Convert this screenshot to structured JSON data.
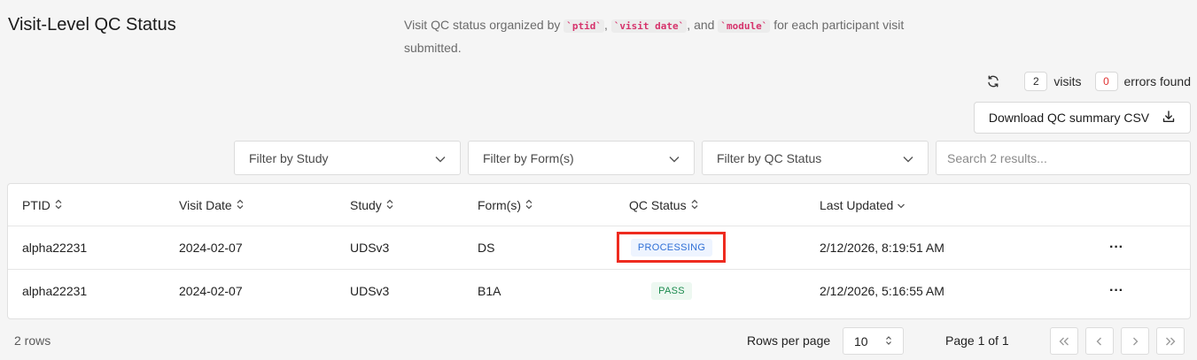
{
  "header": {
    "title": "Visit-Level QC Status",
    "description": {
      "part1": "Visit QC status organized by ",
      "code1": "`ptid`",
      "part2": ", ",
      "code2": "`visit date`",
      "part3": ", and ",
      "code3": "`module`",
      "part4": " for each participant visit submitted."
    }
  },
  "stats": {
    "visits_count": "2",
    "visits_label": "visits",
    "errors_count": "0",
    "errors_label": "errors found"
  },
  "actions": {
    "download_label": "Download QC summary CSV"
  },
  "filters": {
    "study": "Filter by Study",
    "forms": "Filter by Form(s)",
    "qc_status": "Filter by QC Status",
    "search_placeholder": "Search 2 results..."
  },
  "table": {
    "columns": [
      "PTID",
      "Visit Date",
      "Study",
      "Form(s)",
      "QC Status",
      "Last Updated"
    ],
    "rows": [
      {
        "ptid": "alpha22231",
        "visit_date": "2024-02-07",
        "study": "UDSv3",
        "forms": "DS",
        "qc_status": "PROCESSING",
        "last_updated": "2/12/2026, 8:19:51 AM",
        "actions": "···"
      },
      {
        "ptid": "alpha22231",
        "visit_date": "2024-02-07",
        "study": "UDSv3",
        "forms": "B1A",
        "qc_status": "PASS",
        "last_updated": "2/12/2026, 5:16:55 AM",
        "actions": "···"
      }
    ]
  },
  "footer": {
    "rows_count": "2 rows",
    "rows_per_page_label": "Rows per page",
    "rows_per_page_value": "10",
    "page_label": "Page 1 of 1"
  },
  "colors": {
    "processing": "#2f6fd6",
    "pass": "#1b8a4e",
    "error_count": "#e03131",
    "highlight": "#ee2b1f"
  }
}
